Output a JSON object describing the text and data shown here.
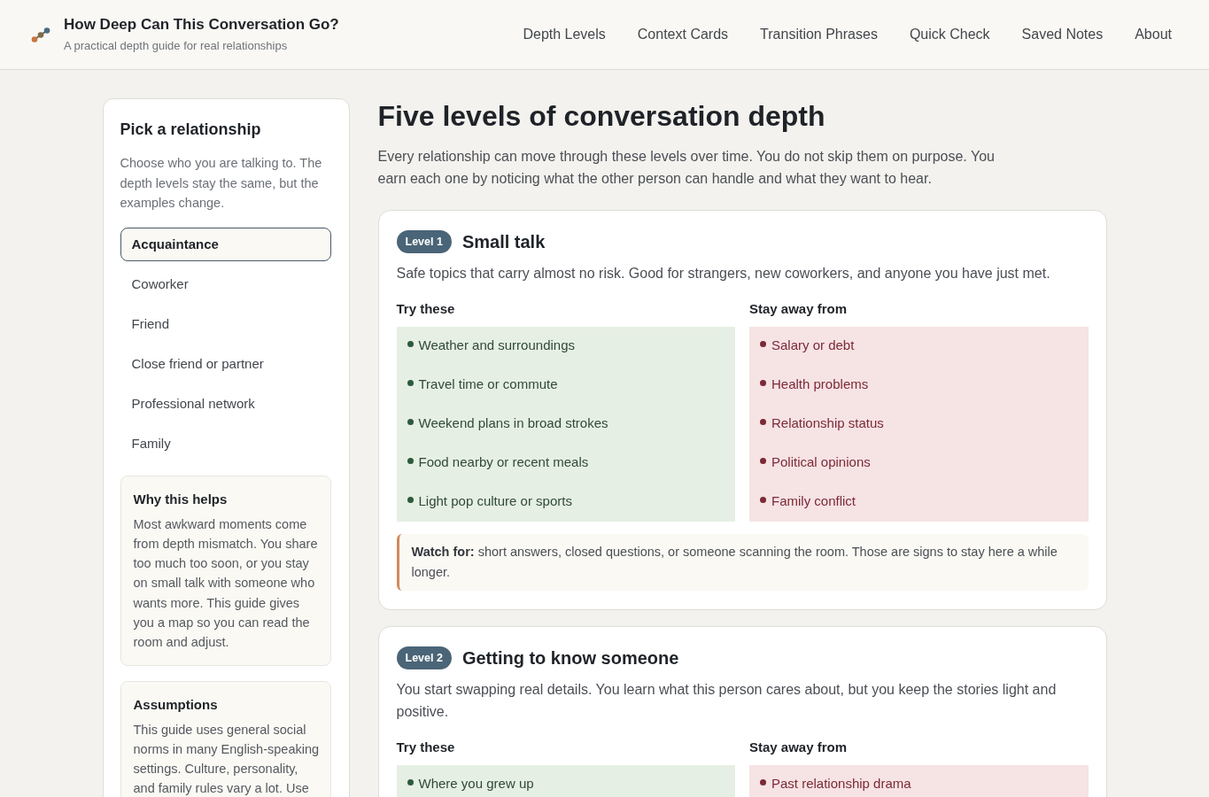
{
  "header": {
    "title": "How Deep Can This Conversation Go?",
    "subtitle": "A practical depth guide for real relationships",
    "nav": [
      "Depth Levels",
      "Context Cards",
      "Transition Phrases",
      "Quick Check",
      "Saved Notes",
      "About"
    ]
  },
  "sidebar": {
    "title": "Pick a relationship",
    "description": "Choose who you are talking to. The depth levels stay the same, but the examples change.",
    "relationships": [
      {
        "label": "Acquaintance",
        "selected": true
      },
      {
        "label": "Coworker",
        "selected": false
      },
      {
        "label": "Friend",
        "selected": false
      },
      {
        "label": "Close friend or partner",
        "selected": false
      },
      {
        "label": "Professional network",
        "selected": false
      },
      {
        "label": "Family",
        "selected": false
      }
    ],
    "notes": [
      {
        "title": "Why this helps",
        "body": "Most awkward moments come from depth mismatch. You share too much too soon, or you stay on small talk with someone who wants more. This guide gives you a map so you can read the room and adjust."
      },
      {
        "title": "Assumptions",
        "body": "This guide uses general social norms in many English-speaking settings. Culture, personality, and family rules vary a lot. Use"
      }
    ]
  },
  "main": {
    "title": "Five levels of conversation depth",
    "intro": "Every relationship can move through these levels over time. You do not skip them on purpose. You earn each one by noticing what the other person can handle and what they want to hear.",
    "levels": [
      {
        "badge": "Level 1",
        "title": "Small talk",
        "description": "Safe topics that carry almost no risk. Good for strangers, new coworkers, and anyone you have just met.",
        "columns": [
          {
            "kind": "try",
            "heading": "Try these",
            "items": [
              "Weather and surroundings",
              "Travel time or commute",
              "Weekend plans in broad strokes",
              "Food nearby or recent meals",
              "Light pop culture or sports"
            ]
          },
          {
            "kind": "avoid",
            "heading": "Stay away from",
            "items": [
              "Salary or debt",
              "Health problems",
              "Relationship status",
              "Political opinions",
              "Family conflict"
            ]
          }
        ],
        "watch": "**Watch for:** short answers, closed questions, or someone scanning the room. Those are signs to stay here a while longer."
      },
      {
        "badge": "Level 2",
        "title": "Getting to know someone",
        "description": "You start swapping real details. You learn what this person cares about, but you keep the stories light and positive.",
        "columns": [
          {
            "kind": "try",
            "heading": "Try these",
            "items": [
              "Where you grew up"
            ]
          },
          {
            "kind": "avoid",
            "heading": "Stay away from",
            "items": [
              "Past relationship drama"
            ]
          }
        ]
      }
    ]
  }
}
